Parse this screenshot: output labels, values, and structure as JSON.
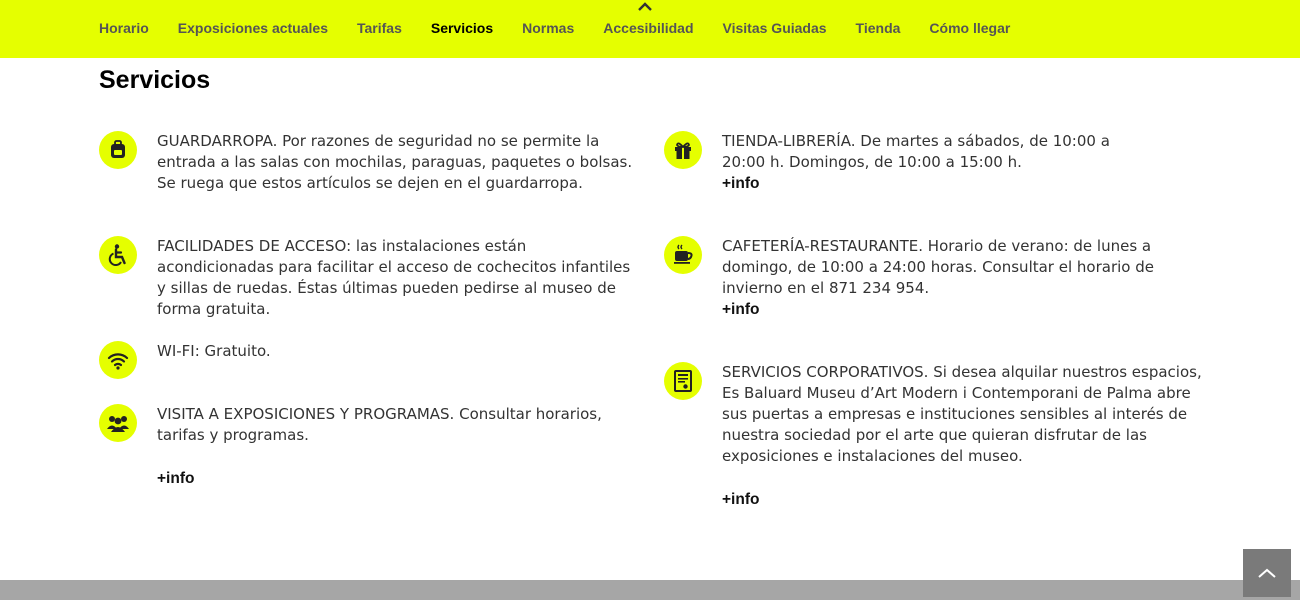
{
  "nav": {
    "items": [
      "Horario",
      "Exposiciones actuales",
      "Tarifas",
      "Servicios",
      "Normas",
      "Accesibilidad",
      "Visitas Guiadas",
      "Tienda",
      "Cómo llegar"
    ],
    "active": "Servicios"
  },
  "page_title": "Servicios",
  "colors": {
    "accent": "#e5ff00",
    "footer": "#a6a6a6",
    "totop": "#7a7a7a"
  },
  "services": {
    "guardarropa": {
      "icon": "backpack-icon",
      "text": "GUARDARROPA. Por razones de seguridad no se permite la entrada a las salas con mochilas, paraguas, paquetes o bolsas. Se ruega que estos artículos se dejen en el guardarropa."
    },
    "acceso": {
      "icon": "wheelchair-icon",
      "text": "FACILIDADES DE ACCESO: las instalaciones están acondicionadas para facilitar el acceso de cochecitos infantiles y sillas de ruedas. Éstas últimas pueden pedirse al museo de forma gratuita."
    },
    "wifi": {
      "icon": "wifi-icon",
      "text": "WI-FI: Gratuito."
    },
    "visita": {
      "icon": "group-icon",
      "text": "VISITA A EXPOSICIONES Y PROGRAMAS. Consultar horarios, tarifas y programas.",
      "more": "+info"
    },
    "tienda": {
      "icon": "gift-icon",
      "text": "TIENDA-LIBRERÍA. De martes a sábados, de 10:00 a 20:00 h. Domingos, de 10:00 a 15:00 h.",
      "more": "+info"
    },
    "cafeteria": {
      "icon": "coffee-cup-icon",
      "text": "CAFETERÍA-RESTAURANTE. Horario de verano: de lunes a domingo, de 10:00 a 24:00 horas. Consultar el horario de invierno en el 871 234 954.",
      "more": "+info"
    },
    "corporativos": {
      "icon": "certificate-icon",
      "text": "SERVICIOS CORPORATIVOS. Si desea alquilar nuestros espacios, Es Baluard Museu d’Art Modern i Contemporani de Palma abre sus puertas a empresas e instituciones sensibles al interés de nuestra sociedad por el arte que quieran disfrutar de las exposiciones e instalaciones del museo.",
      "more": "+info"
    }
  }
}
